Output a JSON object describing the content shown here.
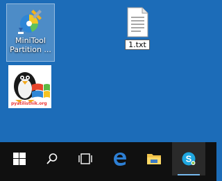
{
  "desktop": {
    "icons": [
      {
        "label": "MiniTool Partition ...",
        "selected": true
      },
      {
        "label": "1.txt",
        "selected": false
      },
      {
        "label": "",
        "watermark": "pyatilistnik.org"
      }
    ]
  },
  "taskbar": {
    "buttons": [
      {
        "icon": "windows-start-icon"
      },
      {
        "icon": "search-icon"
      },
      {
        "icon": "task-view-icon"
      },
      {
        "icon": "edge-icon"
      },
      {
        "icon": "file-explorer-icon"
      },
      {
        "icon": "skype-icon",
        "active": true
      }
    ]
  },
  "colors": {
    "desktop_bg": "#1c6cb8",
    "taskbar_bg": "#101010",
    "accent": "#76b9ed"
  }
}
